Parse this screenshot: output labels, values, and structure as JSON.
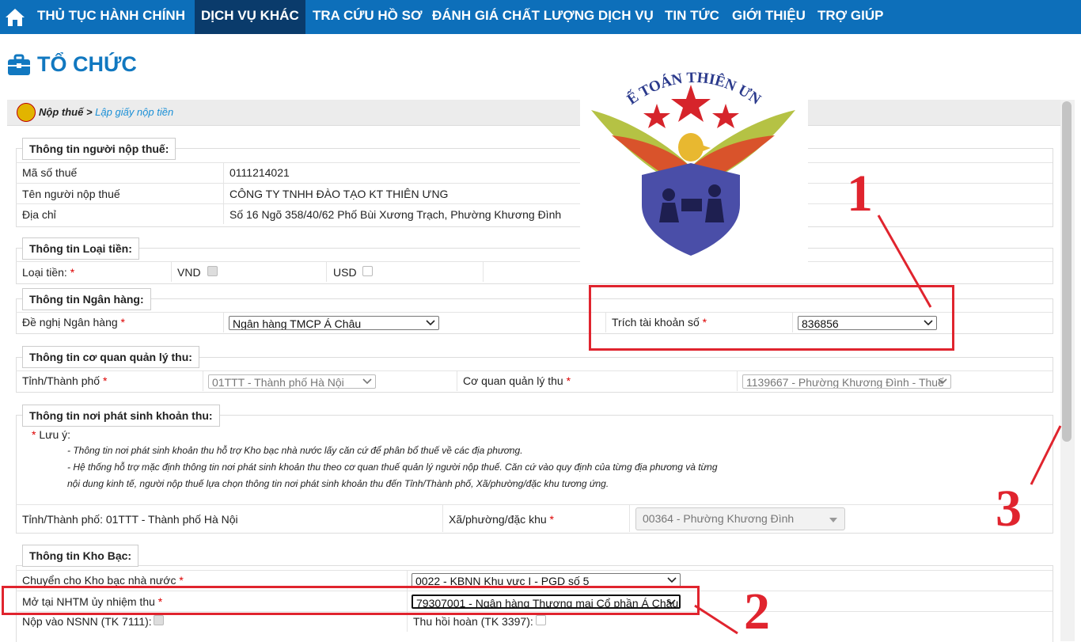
{
  "nav": {
    "items": [
      "THỦ TỤC HÀNH CHÍNH",
      "DỊCH VỤ KHÁC",
      "TRA CỨU HỒ SƠ",
      "ĐÁNH GIÁ CHẤT LƯỢNG DỊCH VỤ",
      "TIN TỨC",
      "GIỚI THIỆU",
      "TRỢ GIÚP"
    ],
    "active": "DỊCH VỤ KHÁC"
  },
  "page_title": "TỔ CHỨC",
  "breadcrumb": {
    "parent": "Nộp thuế",
    "separator": ">",
    "current": "Lập giấy nộp tiền"
  },
  "taxpayer": {
    "legend": "Thông tin người nộp thuế:",
    "tax_code_label": "Mã số thuế",
    "tax_code": "0111214021",
    "name_label": "Tên người nộp thuế",
    "name": "CÔNG TY TNHH ĐÀO TẠO KT THIÊN ƯNG",
    "address_label": "Địa chỉ",
    "address": "Số 16 Ngõ 358/40/62 Phố Bùi Xương Trạch, Phường Khương Đình"
  },
  "currency": {
    "legend": "Thông tin Loại tiền:",
    "label": "Loại tiền:",
    "vnd": "VND",
    "usd": "USD"
  },
  "bank": {
    "legend": "Thông tin Ngân hàng:",
    "bank_label": "Đề nghị Ngân hàng",
    "bank_value": "Ngân hàng TMCP Á Châu",
    "account_label": "Trích tài khoản số",
    "account_value": "836856"
  },
  "agency": {
    "legend": "Thông tin cơ quan quản lý thu:",
    "province_label": "Tỉnh/Thành phố",
    "province_value": "01TTT - Thành phố Hà Nội",
    "agency_label": "Cơ quan quản lý thu",
    "agency_value": "1139667 - Phường Khương Đình - Thuế"
  },
  "origin": {
    "legend": "Thông tin nơi phát sinh khoản thu:",
    "note_label": "Lưu ý:",
    "note1": "- Thông tin nơi phát sinh khoản thu hỗ trợ Kho bạc nhà nước lấy căn cứ để phân bổ thuế về các địa phương.",
    "note2": "- Hệ thống hỗ trợ mặc định thông tin nơi phát sinh khoản thu theo cơ quan thuế quản lý người nộp thuế. Căn cứ vào quy định của từng địa phương và từng",
    "note3": "nội dung kinh tế, người nộp thuế lựa chọn thông tin nơi phát sinh khoản thu đến Tỉnh/Thành phố, Xã/phường/đặc khu tương ứng.",
    "province_text": "Tỉnh/Thành phố: 01TTT - Thành phố Hà Nội",
    "ward_label": "Xã/phường/đặc khu",
    "ward_value": "00364 - Phường Khương Đình"
  },
  "treasury": {
    "legend": "Thông tin Kho Bạc:",
    "transfer_label": "Chuyển cho Kho bạc nhà nước",
    "transfer_value": "0022 - KBNN Khu vực I - PGD số 5",
    "bank_label": "Mở tại NHTM ủy nhiệm thu",
    "bank_value": "79307001 - Ngân hàng Thương mại Cổ phần Á Châu",
    "nsnn_label": "Nộp vào NSNN (TK 7111):",
    "refund_label": "Thu hồi hoàn (TK 3397):"
  },
  "logo": {
    "text": "KẾ TOÁN THIÊN ƯNG"
  },
  "annotations": [
    "1",
    "2",
    "3"
  ],
  "colors": {
    "nav_bg": "#0d6fba",
    "nav_active": "#0a3b6b",
    "title": "#1178c0",
    "red": "#e0242e",
    "link": "#1a8fd6"
  }
}
